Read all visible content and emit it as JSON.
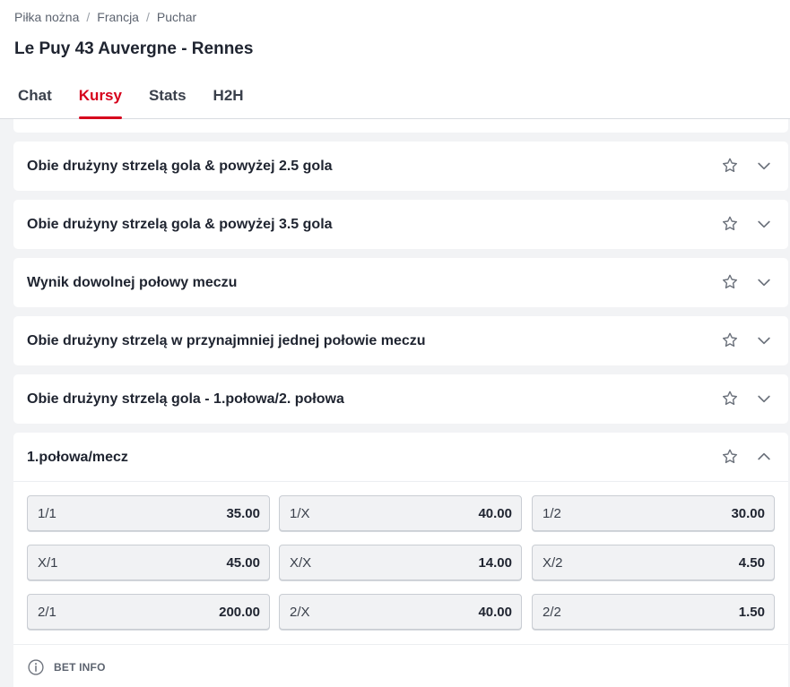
{
  "breadcrumb": [
    "Piłka nożna",
    "Francja",
    "Puchar"
  ],
  "match_title": "Le Puy 43 Auvergne - Rennes",
  "tabs": [
    {
      "label": "Chat"
    },
    {
      "label": "Kursy"
    },
    {
      "label": "Stats"
    },
    {
      "label": "H2H"
    }
  ],
  "active_tab": "Kursy",
  "accent_color": "#d6001c",
  "markets": [
    {
      "title": "Obie drużyny strzelą gola & powyżej 2.5 gola"
    },
    {
      "title": "Obie drużyny strzelą gola & powyżej 3.5 gola"
    },
    {
      "title": "Wynik dowolnej połowy meczu"
    },
    {
      "title": "Obie drużyny strzelą w przynajmniej jednej połowie meczu"
    },
    {
      "title": "Obie drużyny strzelą gola - 1.połowa/2. połowa"
    }
  ],
  "expanded_market": {
    "title": "1.połowa/mecz",
    "odds": [
      {
        "label": "1/1",
        "value": "35.00"
      },
      {
        "label": "1/X",
        "value": "40.00"
      },
      {
        "label": "1/2",
        "value": "30.00"
      },
      {
        "label": "X/1",
        "value": "45.00"
      },
      {
        "label": "X/X",
        "value": "14.00"
      },
      {
        "label": "X/2",
        "value": "4.50"
      },
      {
        "label": "2/1",
        "value": "200.00"
      },
      {
        "label": "2/X",
        "value": "40.00"
      },
      {
        "label": "2/2",
        "value": "1.50"
      }
    ]
  },
  "bet_info_label": "BET INFO",
  "icons": {
    "favorite": "star-icon",
    "expand": "chevron-down-icon",
    "collapse": "chevron-up-icon",
    "info": "info-icon"
  }
}
